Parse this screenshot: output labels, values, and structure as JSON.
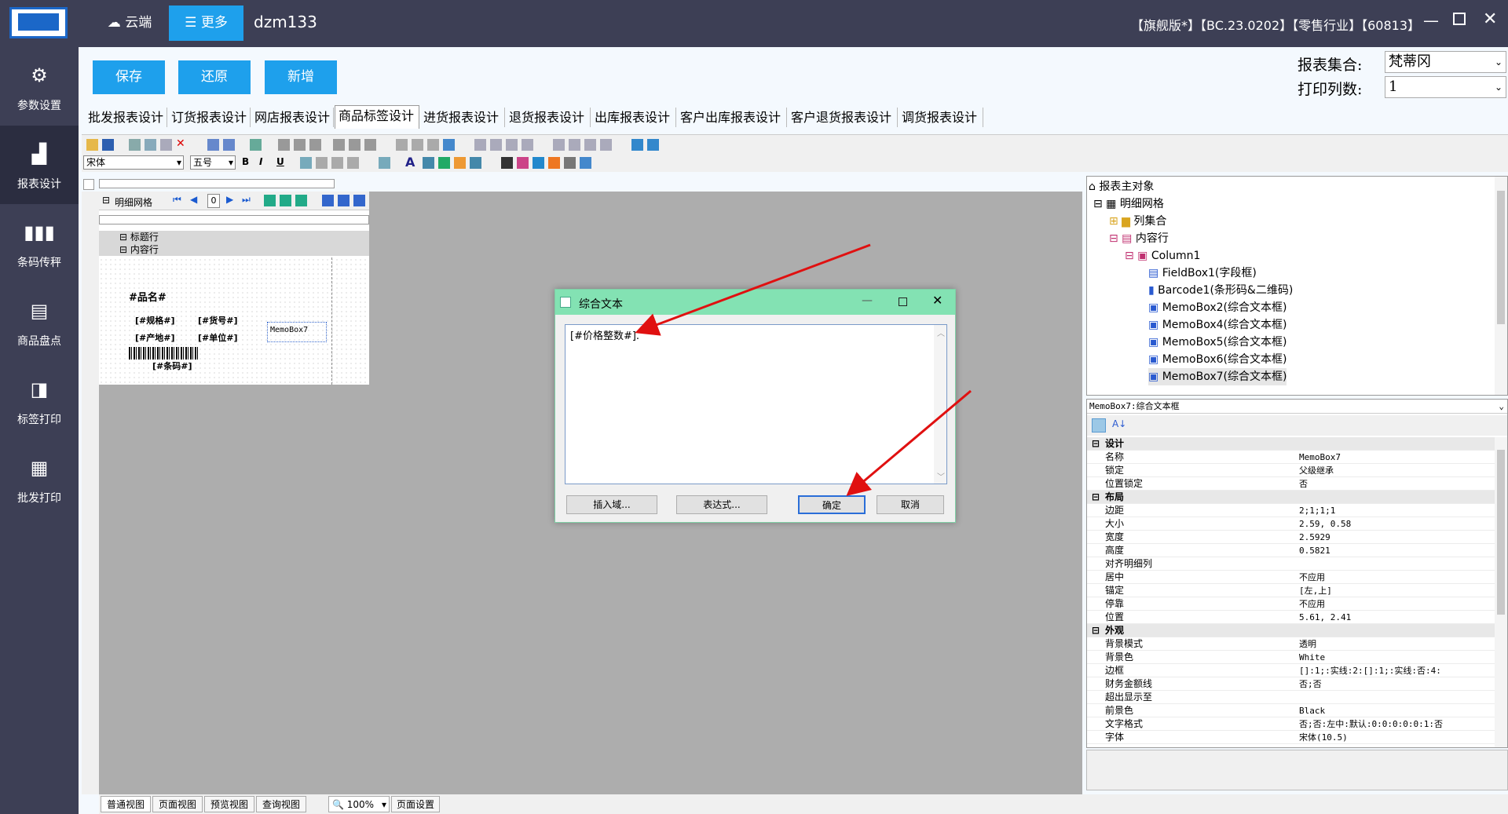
{
  "topbar": {
    "cloud_label": "云端",
    "more_label": "更多",
    "user": "dzm133",
    "version": "【旗舰版*】【BC.23.0202】【零售行业】【60813】"
  },
  "sidebar": {
    "items": [
      {
        "label": "参数设置",
        "icon": "gear-icon"
      },
      {
        "label": "报表设计",
        "icon": "chart-icon"
      },
      {
        "label": "条码传秤",
        "icon": "barcode-icon"
      },
      {
        "label": "商品盘点",
        "icon": "inventory-icon"
      },
      {
        "label": "标签打印",
        "icon": "tag-icon"
      },
      {
        "label": "批发打印",
        "icon": "printer-icon"
      }
    ]
  },
  "toolbar": {
    "save_label": "保存",
    "restore_label": "还原",
    "new_label": "新增",
    "report_set_label": "报表集合:",
    "report_set_value": "梵蒂冈",
    "print_cols_label": "打印列数:",
    "print_cols_value": "1"
  },
  "tabs": [
    "批发报表设计",
    "订货报表设计",
    "网店报表设计",
    "商品标签设计",
    "进货报表设计",
    "退货报表设计",
    "出库报表设计",
    "客户出库报表设计",
    "客户退货报表设计",
    "调货报表设计"
  ],
  "format_bar": {
    "font": "宋体",
    "size": "五号"
  },
  "designer": {
    "grid_label": "明细网格",
    "page_field": "0",
    "title_row": "标题行",
    "content_row": "内容行",
    "fields": {
      "name": "#品名#",
      "spec": "[#规格#]",
      "code": "[#货号#]",
      "origin": "[#产地#]",
      "unit": "[#单位#]",
      "memo": "MemoBox7",
      "barcode": "[#条码#]"
    }
  },
  "dialog": {
    "title": "综合文本",
    "text": "[#价格整数#].",
    "insert_field": "插入域...",
    "expression": "表达式...",
    "ok": "确定",
    "cancel": "取消"
  },
  "tree": {
    "items": [
      "报表主对象",
      "明细网格",
      "列集合",
      "内容行",
      "Column1",
      "FieldBox1(字段框)",
      "Barcode1(条形码&二维码)",
      "MemoBox2(综合文本框)",
      "MemoBox4(综合文本框)",
      "MemoBox5(综合文本框)",
      "MemoBox6(综合文本框)",
      "MemoBox7(综合文本框)"
    ]
  },
  "props": {
    "selector": "MemoBox7:综合文本框",
    "rows": [
      {
        "k": "设计",
        "v": "",
        "cat": true
      },
      {
        "k": "名称",
        "v": "MemoBox7"
      },
      {
        "k": "锁定",
        "v": "父级继承"
      },
      {
        "k": "位置锁定",
        "v": "否"
      },
      {
        "k": "布局",
        "v": "",
        "cat": true
      },
      {
        "k": "边距",
        "v": "2;1;1;1"
      },
      {
        "k": "大小",
        "v": "2.59, 0.58"
      },
      {
        "k": "宽度",
        "v": "2.5929"
      },
      {
        "k": "高度",
        "v": "0.5821"
      },
      {
        "k": "对齐明细列",
        "v": ""
      },
      {
        "k": "居中",
        "v": "不应用"
      },
      {
        "k": "锚定",
        "v": "[左,上]"
      },
      {
        "k": "停靠",
        "v": "不应用"
      },
      {
        "k": "位置",
        "v": "5.61, 2.41"
      },
      {
        "k": "外观",
        "v": "",
        "cat": true
      },
      {
        "k": "背景模式",
        "v": "透明"
      },
      {
        "k": "背景色",
        "v": "White"
      },
      {
        "k": "边框",
        "v": "[]:1;:实线:2:[]:1;:实线:否:4:"
      },
      {
        "k": "财务金额线",
        "v": "否;否"
      },
      {
        "k": "超出显示至",
        "v": ""
      },
      {
        "k": "前景色",
        "v": "Black"
      },
      {
        "k": "文字格式",
        "v": "否;否:左中:默认:0:0:0:0:0:1:否"
      },
      {
        "k": "字体",
        "v": "宋体(10.5)"
      }
    ]
  },
  "bottom": {
    "tabs": [
      "普通视图",
      "页面视图",
      "预览视图",
      "查询视图"
    ],
    "zoom": "100%",
    "page_setup": "页面设置"
  },
  "colors": {
    "sidebar": "#3d3f55",
    "accent": "#1ea0ec",
    "dialog_title": "#83e2b3"
  }
}
